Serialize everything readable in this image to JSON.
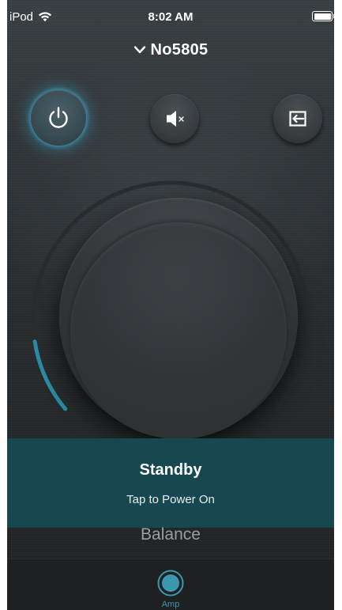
{
  "status_bar": {
    "carrier": "iPod",
    "time": "8:02 AM",
    "wifi_icon": "wifi-icon",
    "battery_icon": "battery-icon",
    "battery_level": 1.0
  },
  "header": {
    "device_name": "No5805",
    "dropdown_icon": "chevron-down-icon"
  },
  "controls": {
    "power_icon": "power-icon",
    "mute_icon": "speaker-mute-icon",
    "input_icon": "input-source-icon",
    "power_state": "standby"
  },
  "volume": {
    "level": 0.12
  },
  "standby": {
    "title": "Standby",
    "subtitle": "Tap to Power On"
  },
  "balance": {
    "label": "Balance"
  },
  "tab_bar": {
    "tabs": [
      {
        "label": "Amp",
        "icon": "amp-knob-icon",
        "selected": true
      }
    ]
  },
  "colors": {
    "accent": "#3a99b0",
    "banner": "#174852",
    "background": "#2e3235",
    "glow": "#3896b4"
  }
}
